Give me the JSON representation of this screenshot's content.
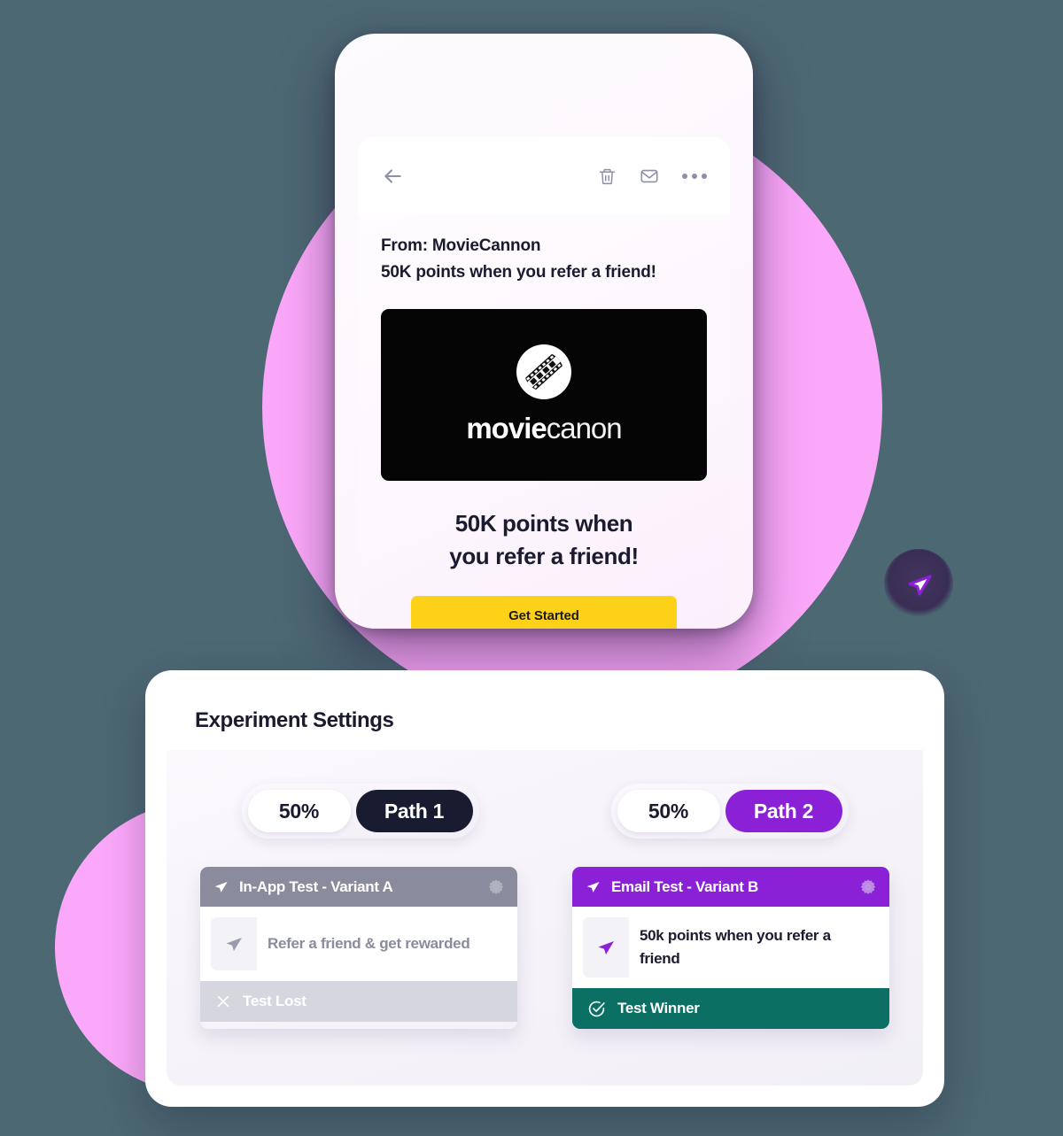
{
  "theme": {
    "background": "#4c6873",
    "blob_pink": "#fca8fa",
    "accent_purple": "#8b21d6",
    "accent_navy": "#191b31",
    "accent_yellow": "#fdd117",
    "accent_teal": "#0b7063",
    "muted_grey": "#8a8b9c"
  },
  "phone": {
    "toolbar": {
      "back_icon": "back-arrow-icon",
      "trash_icon": "trash-icon",
      "envelope_icon": "envelope-icon",
      "more_icon": "more-options-icon"
    },
    "email": {
      "from": "From: MovieCannon",
      "subject": "50K points when you refer a friend!",
      "hero": {
        "logo_icon": "film-strip-icon",
        "brand_bold": "movie",
        "brand_light": "canon"
      },
      "headline_line1": "50K points when",
      "headline_line2": "you refer a friend!",
      "cta_label": "Get Started"
    }
  },
  "send_badge": {
    "icon": "send-paper-plane-icon"
  },
  "settings": {
    "title": "Experiment Settings",
    "paths": [
      {
        "percent": "50%",
        "label": "Path 1",
        "color": "#191b31"
      },
      {
        "percent": "50%",
        "label": "Path 2",
        "color": "#8b21d6"
      }
    ],
    "variants": [
      {
        "header_icon": "send-paper-plane-icon",
        "title": "In-App Test - Variant A",
        "gear_icon": "gear-icon",
        "message_icon": "send-paper-plane-icon",
        "message": "Refer a friend & get rewarded",
        "status_icon": "close-x-icon",
        "status": "Test Lost",
        "header_color": "#8a8b9c",
        "status_color": "#d6d6de"
      },
      {
        "header_icon": "send-paper-plane-icon",
        "title": "Email Test - Variant B",
        "gear_icon": "gear-icon",
        "message_icon": "send-paper-plane-icon",
        "message": "50k points when you refer a friend",
        "status_icon": "check-circle-icon",
        "status": "Test Winner",
        "header_color": "#8b21d6",
        "status_color": "#0b7063"
      }
    ]
  }
}
